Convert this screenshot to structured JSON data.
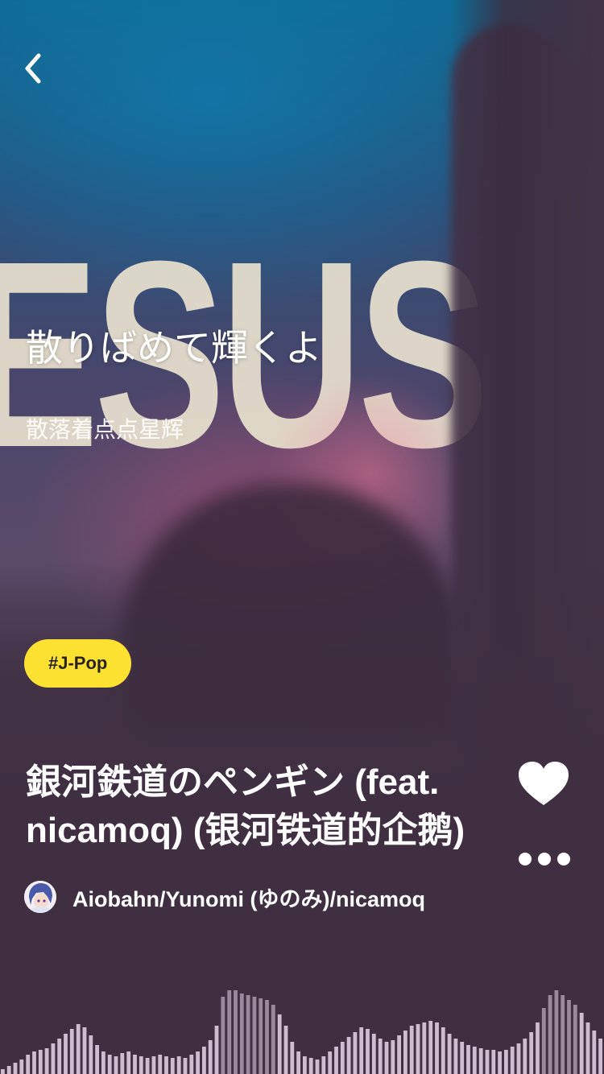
{
  "background": {
    "word": "ESUS"
  },
  "nav": {
    "back_icon": "chevron-left-icon"
  },
  "lyrics": {
    "current_line": "散りばめて輝くよ",
    "translation": "散落着点点星辉"
  },
  "tag": {
    "label": "#J-Pop",
    "color": "#fde130"
  },
  "track": {
    "title": "銀河鉄道のペンギン (feat. nicamoq) (银河铁道的企鹅)",
    "artists": "Aiobahn/Yunomi (ゆのみ)/nicamoq",
    "avatar_icon": "artist-avatar",
    "like_icon": "heart-icon",
    "more_icon": "more-dots-icon"
  },
  "waveform": {
    "color": "#e7d6ea"
  }
}
